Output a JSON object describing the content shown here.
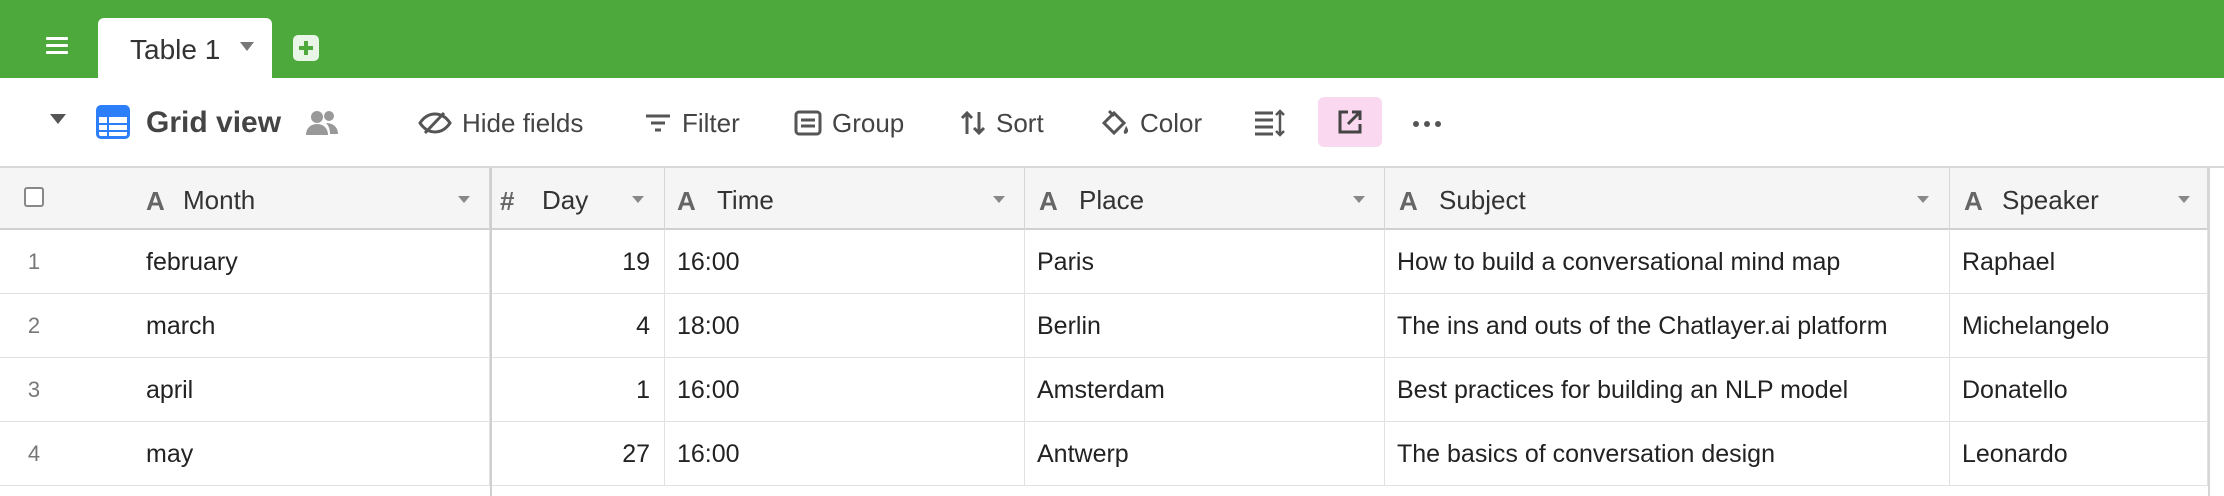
{
  "tabs": [
    {
      "label": "Table 1",
      "active": true
    }
  ],
  "view": {
    "name": "Grid view"
  },
  "toolbar": {
    "hide_fields": "Hide fields",
    "filter": "Filter",
    "group": "Group",
    "sort": "Sort",
    "color": "Color",
    "icons": [
      "row-height-icon",
      "share-view-icon",
      "more-icon"
    ]
  },
  "colors": {
    "brand_green": "#4ea93d",
    "grid_blue": "#2d7ff9",
    "share_pink": "#f9d8f0"
  },
  "table": {
    "columns": [
      {
        "label": "Month",
        "type": "text"
      },
      {
        "label": "Day",
        "type": "number"
      },
      {
        "label": "Time",
        "type": "text"
      },
      {
        "label": "Place",
        "type": "text"
      },
      {
        "label": "Subject",
        "type": "text"
      },
      {
        "label": "Speaker",
        "type": "text"
      }
    ],
    "rows": [
      {
        "num": "1",
        "cells": [
          "february",
          "19",
          "16:00",
          "Paris",
          "How to build a conversational mind map",
          "Raphael"
        ]
      },
      {
        "num": "2",
        "cells": [
          "march",
          "4",
          "18:00",
          "Berlin",
          "The ins and outs of the Chatlayer.ai platform",
          "Michelangelo"
        ]
      },
      {
        "num": "3",
        "cells": [
          "april",
          "1",
          "16:00",
          "Amsterdam",
          "Best practices for building an NLP model",
          "Donatello"
        ]
      },
      {
        "num": "4",
        "cells": [
          "may",
          "27",
          "16:00",
          "Antwerp",
          "The basics of conversation design",
          "Leonardo"
        ]
      }
    ]
  }
}
